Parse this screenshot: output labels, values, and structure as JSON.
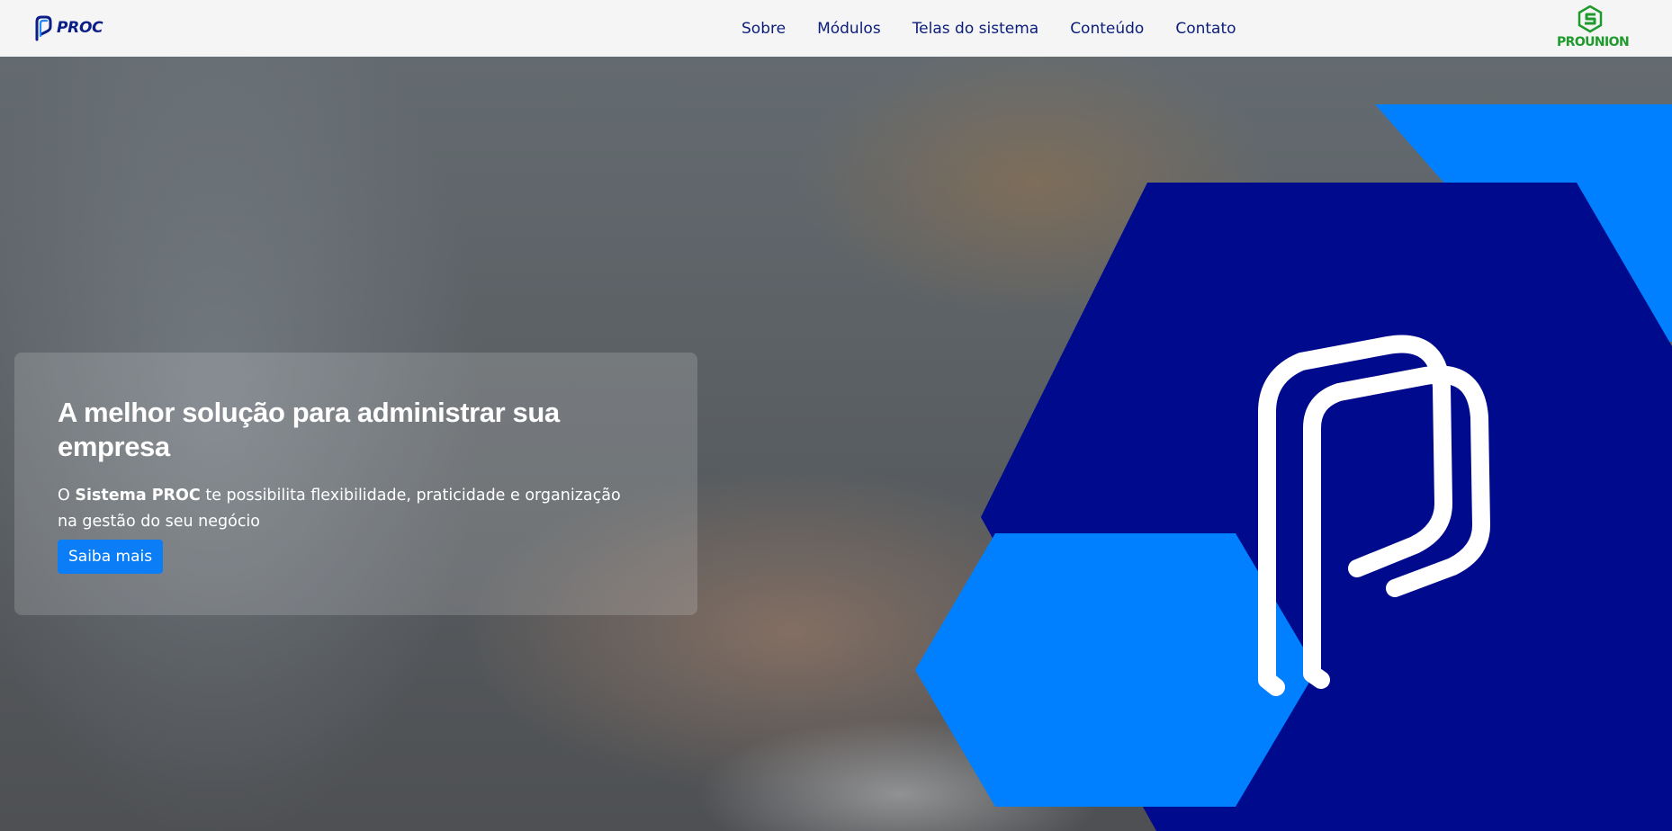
{
  "header": {
    "brand_text": "PROC",
    "nav_links": [
      "Sobre",
      "Módulos",
      "Telas do sistema",
      "Conteúdo",
      "Contato"
    ],
    "partner_text": "PROUNION"
  },
  "hero": {
    "title": "A melhor solução para administrar sua empresa",
    "desc_prefix": "O ",
    "desc_bold": "Sistema PROC",
    "desc_suffix": " te possibilita flexibilidade, praticidade e organização na gestão do seu negócio",
    "cta_label": "Saiba mais"
  },
  "colors": {
    "nav_bg": "#f5f5f5",
    "nav_text": "#0b1d7a",
    "hex_dark": "#000a8c",
    "hex_light": "#0080ff",
    "cta_bg": "#0a7df7",
    "partner_green": "#1f9a2c"
  },
  "icons": {
    "brand_logo": "proc-p-logo-icon",
    "partner_logo": "prounion-logo-icon",
    "hero_logo": "proc-p-logo-icon"
  }
}
